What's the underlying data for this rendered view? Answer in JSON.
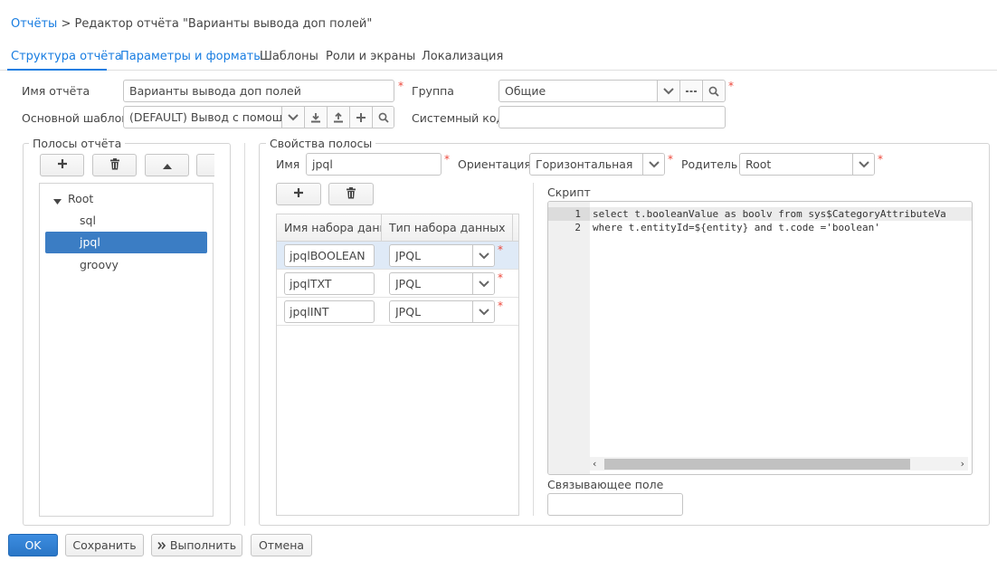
{
  "breadcrumb": {
    "root": "Отчёты",
    "separator": ">",
    "current": "Редактор отчёта \"Варианты вывода доп полей\""
  },
  "tabs": [
    {
      "label": "Структура отчёта",
      "active": true
    },
    {
      "label": "Параметры и форматы"
    },
    {
      "label": "Шаблоны"
    },
    {
      "label": "Роли и экраны"
    },
    {
      "label": "Локализация"
    }
  ],
  "form": {
    "name_label": "Имя отчёта",
    "name_value": "Варианты вывода доп полей",
    "group_label": "Группа",
    "group_value": "Общие",
    "template_label": "Основной шаблон",
    "template_value": "(DEFAULT) Вывод с помощью",
    "syscode_label": "Системный код",
    "syscode_value": "",
    "required_mark": "*"
  },
  "bands_panel": {
    "title": "Полосы отчёта",
    "tree": {
      "root": "Root",
      "children": [
        "sql",
        "jpql",
        "groovy"
      ],
      "selected": "jpql"
    }
  },
  "band_props": {
    "title": "Свойства полосы",
    "name_label": "Имя",
    "name_value": "jpql",
    "orientation_label": "Ориентация",
    "orientation_value": "Горизонтальная",
    "parent_label": "Родитель",
    "parent_value": "Root",
    "datasets": {
      "columns": [
        "Имя набора данных",
        "Тип набора данных"
      ],
      "rows": [
        {
          "name": "jpqlBOOLEAN",
          "type": "JPQL"
        },
        {
          "name": "jpqlTXT",
          "type": "JPQL"
        },
        {
          "name": "jpqlINT",
          "type": "JPQL"
        }
      ]
    },
    "script_label": "Скрипт",
    "script_lines": [
      {
        "n": "1",
        "text": "select t.booleanValue as boolv from sys$CategoryAttributeVa"
      },
      {
        "n": "2",
        "text": "where t.entityId=${entity} and t.code ='boolean'"
      }
    ],
    "link_field_label": "Связывающее поле",
    "link_field_value": ""
  },
  "footer": {
    "ok": "OK",
    "save": "Сохранить",
    "run": "Выполнить",
    "cancel": "Отмена"
  },
  "colors": {
    "accent": "#197de1",
    "selected": "#3b7dc4",
    "required": "#ed473b"
  }
}
